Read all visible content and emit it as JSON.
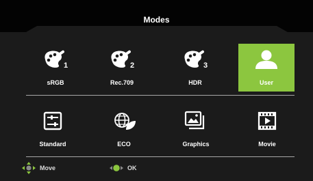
{
  "title": "Modes",
  "accent_color": "#8cc63f",
  "modes_row1": [
    {
      "label": "sRGB",
      "icon": "palette-1-icon",
      "badge": "1"
    },
    {
      "label": "Rec.709",
      "icon": "palette-2-icon",
      "badge": "2"
    },
    {
      "label": "HDR",
      "icon": "palette-3-icon",
      "badge": "3"
    },
    {
      "label": "User",
      "icon": "user-icon",
      "selected": true
    }
  ],
  "modes_row2": [
    {
      "label": "Standard",
      "icon": "sliders-icon"
    },
    {
      "label": "ECO",
      "icon": "globe-leaf-icon"
    },
    {
      "label": "Graphics",
      "icon": "images-icon"
    },
    {
      "label": "Movie",
      "icon": "film-play-icon"
    }
  ],
  "footer": {
    "move_label": "Move",
    "ok_label": "OK"
  }
}
